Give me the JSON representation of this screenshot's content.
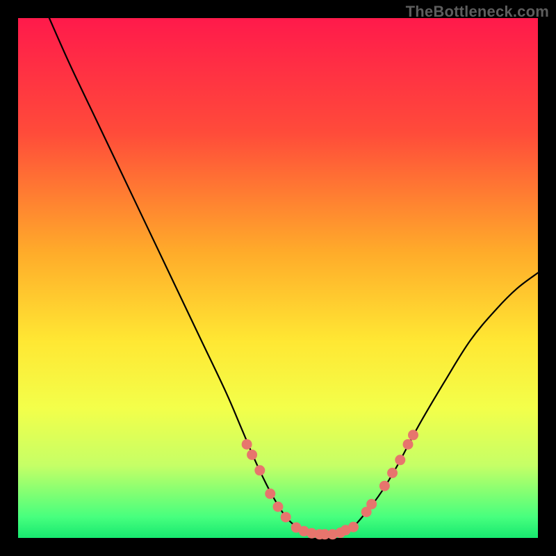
{
  "watermark": "TheBottleneck.com",
  "chart_data": {
    "type": "line",
    "title": "",
    "xlabel": "",
    "ylabel": "",
    "xlim": [
      0,
      100
    ],
    "ylim": [
      0,
      100
    ],
    "grid": false,
    "legend": "none",
    "background": {
      "type": "vertical-gradient",
      "stops": [
        {
          "offset": 0,
          "color": "#ff1a4b"
        },
        {
          "offset": 22,
          "color": "#ff4b3a"
        },
        {
          "offset": 45,
          "color": "#ffab2a"
        },
        {
          "offset": 62,
          "color": "#ffe733"
        },
        {
          "offset": 75,
          "color": "#f3ff4a"
        },
        {
          "offset": 86,
          "color": "#c6ff66"
        },
        {
          "offset": 96,
          "color": "#47ff7e"
        },
        {
          "offset": 100,
          "color": "#17e86f"
        }
      ]
    },
    "frame_color": "#000000",
    "series": [
      {
        "name": "bottleneck-curve",
        "color": "#000000",
        "points": [
          {
            "x": 6.0,
            "y": 100.0
          },
          {
            "x": 10.0,
            "y": 91.0
          },
          {
            "x": 15.0,
            "y": 80.5
          },
          {
            "x": 20.0,
            "y": 70.0
          },
          {
            "x": 25.0,
            "y": 59.5
          },
          {
            "x": 30.0,
            "y": 49.0
          },
          {
            "x": 35.0,
            "y": 38.5
          },
          {
            "x": 40.0,
            "y": 28.0
          },
          {
            "x": 43.0,
            "y": 21.0
          },
          {
            "x": 46.0,
            "y": 14.0
          },
          {
            "x": 49.0,
            "y": 8.0
          },
          {
            "x": 52.0,
            "y": 3.5
          },
          {
            "x": 55.0,
            "y": 1.5
          },
          {
            "x": 58.0,
            "y": 0.7
          },
          {
            "x": 61.0,
            "y": 0.7
          },
          {
            "x": 64.0,
            "y": 1.8
          },
          {
            "x": 67.0,
            "y": 5.0
          },
          {
            "x": 70.0,
            "y": 9.0
          },
          {
            "x": 73.0,
            "y": 14.0
          },
          {
            "x": 77.0,
            "y": 21.5
          },
          {
            "x": 82.0,
            "y": 30.0
          },
          {
            "x": 87.0,
            "y": 38.0
          },
          {
            "x": 92.0,
            "y": 44.0
          },
          {
            "x": 96.0,
            "y": 48.0
          },
          {
            "x": 100.0,
            "y": 51.0
          }
        ]
      },
      {
        "name": "highlight-dots",
        "color": "#e7756d",
        "radius": 7.5,
        "points": [
          {
            "x": 44.0,
            "y": 18.0
          },
          {
            "x": 45.0,
            "y": 16.0
          },
          {
            "x": 46.5,
            "y": 13.0
          },
          {
            "x": 48.5,
            "y": 8.5
          },
          {
            "x": 50.0,
            "y": 6.0
          },
          {
            "x": 51.5,
            "y": 4.0
          },
          {
            "x": 53.5,
            "y": 2.0
          },
          {
            "x": 55.0,
            "y": 1.3
          },
          {
            "x": 56.5,
            "y": 0.9
          },
          {
            "x": 58.0,
            "y": 0.7
          },
          {
            "x": 59.0,
            "y": 0.7
          },
          {
            "x": 60.5,
            "y": 0.7
          },
          {
            "x": 62.0,
            "y": 1.0
          },
          {
            "x": 63.0,
            "y": 1.5
          },
          {
            "x": 64.5,
            "y": 2.1
          },
          {
            "x": 67.0,
            "y": 5.0
          },
          {
            "x": 68.0,
            "y": 6.5
          },
          {
            "x": 70.5,
            "y": 10.0
          },
          {
            "x": 72.0,
            "y": 12.5
          },
          {
            "x": 73.5,
            "y": 15.0
          },
          {
            "x": 75.0,
            "y": 18.0
          },
          {
            "x": 76.0,
            "y": 19.8
          }
        ]
      }
    ]
  }
}
